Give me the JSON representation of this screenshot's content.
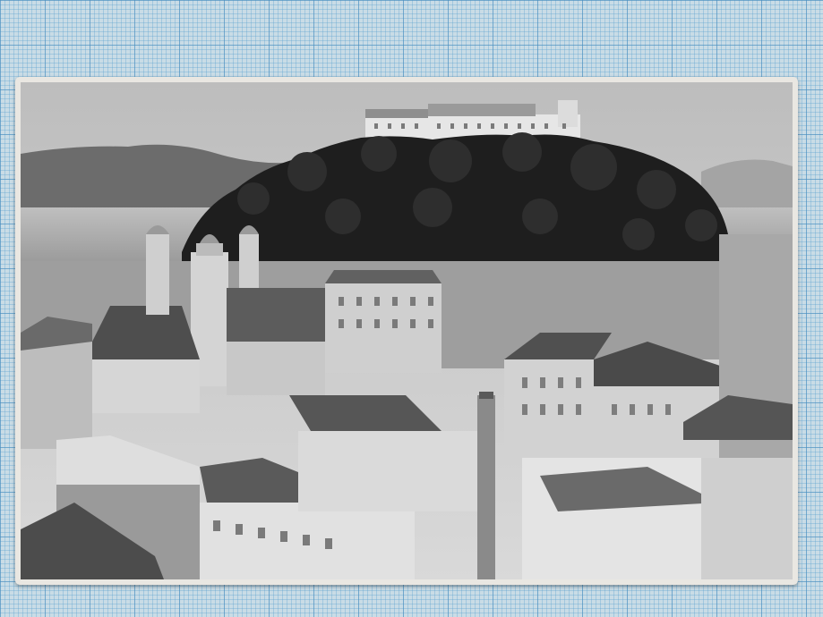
{
  "image": {
    "subject": "photo-postcard",
    "colors": {
      "grid_paper": "#c9dce6",
      "grid_lines": "#468cbe",
      "card_border": "#e9e7e2",
      "sky": "#cfcfcf",
      "forest": "#1f1f1f",
      "rooftops": "#5a5a5a",
      "walls": "#e2e2e2"
    }
  }
}
